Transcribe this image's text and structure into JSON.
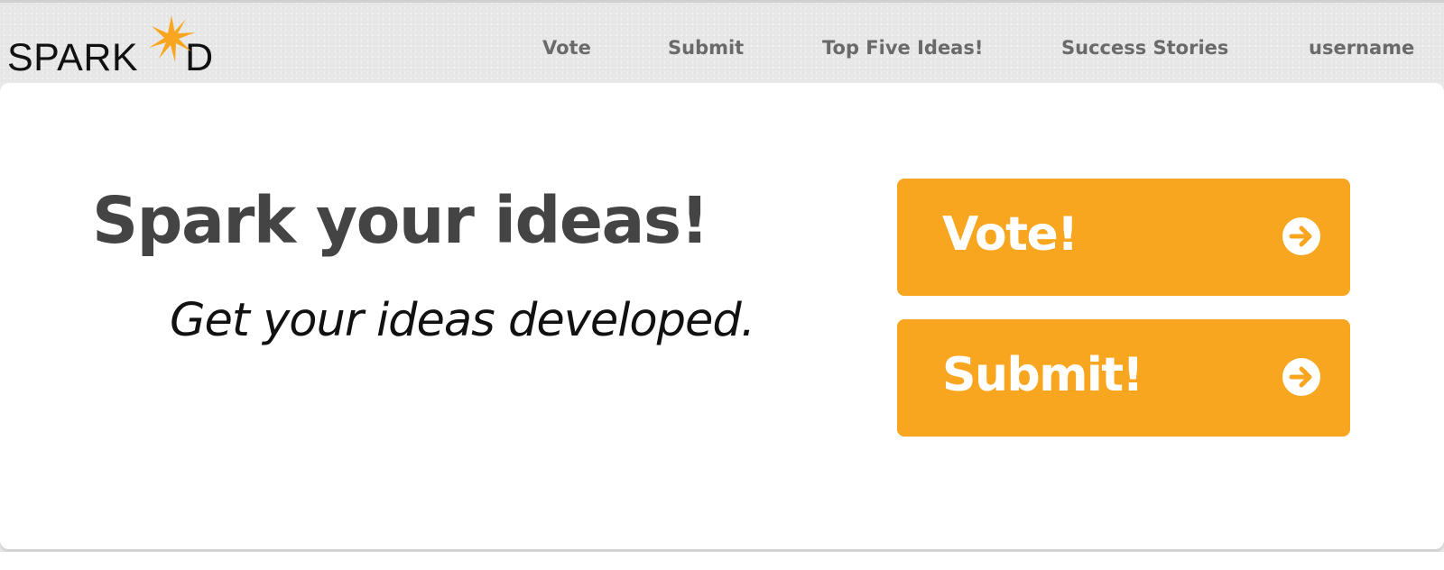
{
  "brand": {
    "logo_text": "SPARK'D",
    "logo_left": "SPARK",
    "logo_right": "D",
    "star_color": "#f8a61f"
  },
  "nav": {
    "items": [
      {
        "label": "Vote"
      },
      {
        "label": "Submit"
      },
      {
        "label": "Top Five Ideas!"
      },
      {
        "label": "Success Stories"
      },
      {
        "label": "username"
      }
    ]
  },
  "hero": {
    "headline": "Spark your ideas!",
    "subheadline": "Get your ideas developed."
  },
  "actions": {
    "vote_label": "Vote!",
    "submit_label": "Submit!",
    "icon": "arrow-circle-right-icon",
    "accent_color": "#f8a61f"
  }
}
